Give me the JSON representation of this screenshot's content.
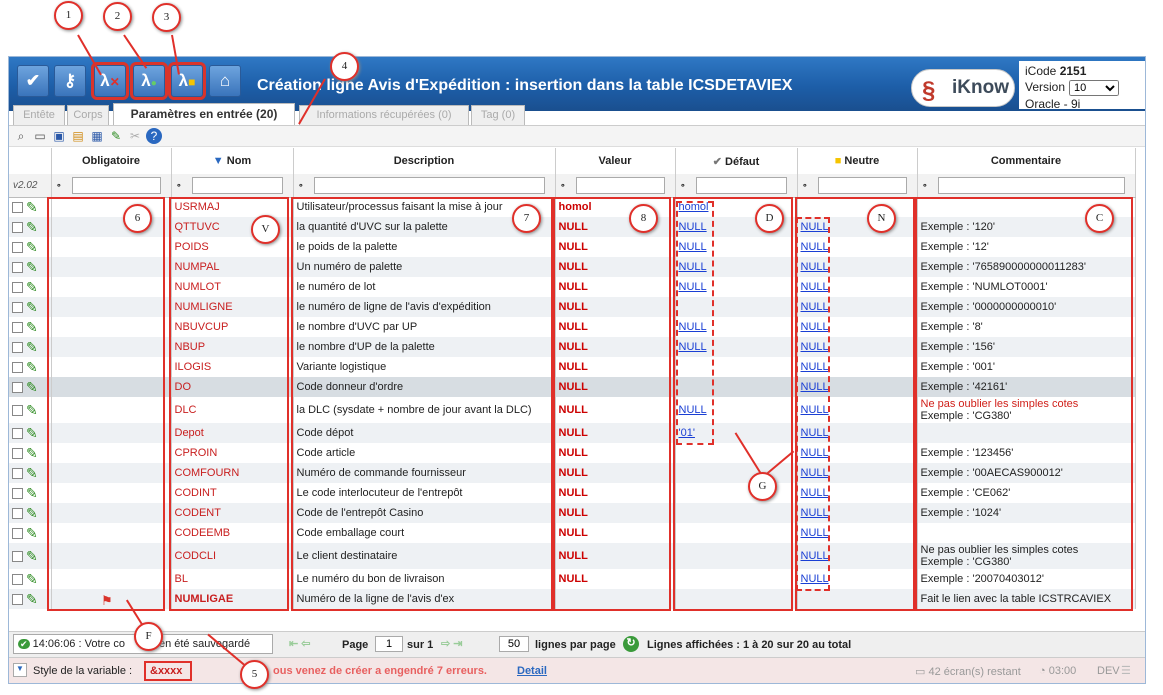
{
  "title": "Création ligne Avis d'Expédition : insertion dans la table ICSDETAVIEX",
  "brand": "iKnow",
  "info": {
    "icode_label": "iCode",
    "icode": "2151",
    "version_label": "Version",
    "version": "10",
    "db": "Oracle - 9i"
  },
  "tabs": [
    "Entête",
    "Corps",
    "Paramètres en entrée (20)",
    "Informations récupérées (0)",
    "Tag (0)"
  ],
  "side_version": "v2.02",
  "columns": {
    "obligatoire": "Obligatoire",
    "nom": "Nom",
    "description": "Description",
    "valeur": "Valeur",
    "defaut": "Défaut",
    "neutre": "Neutre",
    "commentaire": "Commentaire"
  },
  "rows": [
    {
      "nom": "USRMAJ",
      "desc": "Utilisateur/processus faisant la mise à jour",
      "val": "homol",
      "def": "homol",
      "neu": "",
      "com": ""
    },
    {
      "nom": "QTTUVC",
      "desc": "la quantité d'UVC sur la palette",
      "val": "NULL",
      "def": "NULL",
      "neu": "NULL",
      "com": "Exemple : '120'"
    },
    {
      "nom": "POIDS",
      "desc": "le poids de la palette",
      "val": "NULL",
      "def": "NULL",
      "neu": "NULL",
      "com": "Exemple : '12'"
    },
    {
      "nom": "NUMPAL",
      "desc": "Un numéro de palette",
      "val": "NULL",
      "def": "NULL",
      "neu": "NULL",
      "com": "Exemple : '765890000000011283'"
    },
    {
      "nom": "NUMLOT",
      "desc": "le numéro de lot",
      "val": "NULL",
      "def": "NULL",
      "neu": "NULL",
      "com": "Exemple : 'NUMLOT0001'"
    },
    {
      "nom": "NUMLIGNE",
      "desc": "le numéro de ligne de l'avis d'expédition",
      "val": "NULL",
      "def": "",
      "neu": "NULL",
      "com": "Exemple : '0000000000010'"
    },
    {
      "nom": "NBUVCUP",
      "desc": "le nombre d'UVC par UP",
      "val": "NULL",
      "def": "NULL",
      "neu": "NULL",
      "com": "Exemple : '8'"
    },
    {
      "nom": "NBUP",
      "desc": "le nombre d'UP de la palette",
      "val": "NULL",
      "def": "NULL",
      "neu": "NULL",
      "com": "Exemple : '156'"
    },
    {
      "nom": "ILOGIS",
      "desc": "Variante logistique",
      "val": "NULL",
      "def": "",
      "neu": "NULL",
      "com": "Exemple : '001'"
    },
    {
      "nom": "DO",
      "desc": "Code donneur d'ordre",
      "val": "NULL",
      "def": "",
      "neu": "NULL",
      "com": "Exemple : '42161'"
    },
    {
      "nom": "DLC",
      "desc": "la DLC (sysdate + nombre de jour avant la DLC)",
      "val": "NULL",
      "def": "NULL",
      "neu": "NULL",
      "com": "Ne pas oublier les simples cotes",
      "com2": "Exemple : 'CG380'"
    },
    {
      "nom": "Depot",
      "desc": "Code dépot",
      "val": "NULL",
      "def": "'01'",
      "neu": "NULL",
      "com": ""
    },
    {
      "nom": "CPROIN",
      "desc": "Code article",
      "val": "NULL",
      "def": "",
      "neu": "NULL",
      "com": "Exemple : '123456'"
    },
    {
      "nom": "COMFOURN",
      "desc": "Numéro de commande fournisseur",
      "val": "NULL",
      "def": "",
      "neu": "NULL",
      "com": "Exemple : '00AECAS900012'"
    },
    {
      "nom": "CODINT",
      "desc": "Le code interlocuteur de l'entrepôt",
      "val": "NULL",
      "def": "",
      "neu": "NULL",
      "com": "Exemple : 'CE062'"
    },
    {
      "nom": "CODENT",
      "desc": "Code de l'entrepôt Casino",
      "val": "NULL",
      "def": "",
      "neu": "NULL",
      "com": "Exemple : '1024'"
    },
    {
      "nom": "CODEEMB",
      "desc": "Code emballage court",
      "val": "NULL",
      "def": "",
      "neu": "NULL",
      "com": ""
    },
    {
      "nom": "CODCLI",
      "desc": "Le client destinataire",
      "val": "NULL",
      "def": "",
      "neu": "NULL",
      "com": "Ne pas oublier les simples cotes",
      "com2": "Exemple : 'CG380'"
    },
    {
      "nom": "BL",
      "desc": "Le numéro du bon de livraison",
      "val": "NULL",
      "def": "",
      "neu": "NULL",
      "com": "Exemple : '20070403012'"
    },
    {
      "nom": "NUMLIGAE",
      "desc": "Numéro de la ligne de l'avis d'ex",
      "val": "",
      "def": "",
      "neu": "",
      "com": "Fait le lien avec la table ICSTRCAVIEX"
    }
  ],
  "pager": {
    "page_label": "Page",
    "page": "1",
    "sur_label": "sur 1",
    "per_page": "50",
    "per_page_label": "lignes par page",
    "shown": "Lignes affichées : 1 à 20 sur 20 au total"
  },
  "status": {
    "saved": "14:06:06 : Votre co",
    "saved2": "en été sauvegardé",
    "style_label": "Style de la variable :",
    "style_value": "&xxxx",
    "warn": "ous venez de créer a engendré 7 erreurs.",
    "detail": "Detail",
    "screens": "42 écran(s) restant",
    "time": "03:00",
    "env": "DEV"
  },
  "annotations": [
    "1",
    "2",
    "3",
    "4",
    "5",
    "6",
    "V",
    "7",
    "8",
    "D",
    "N",
    "C",
    "G",
    "F"
  ]
}
